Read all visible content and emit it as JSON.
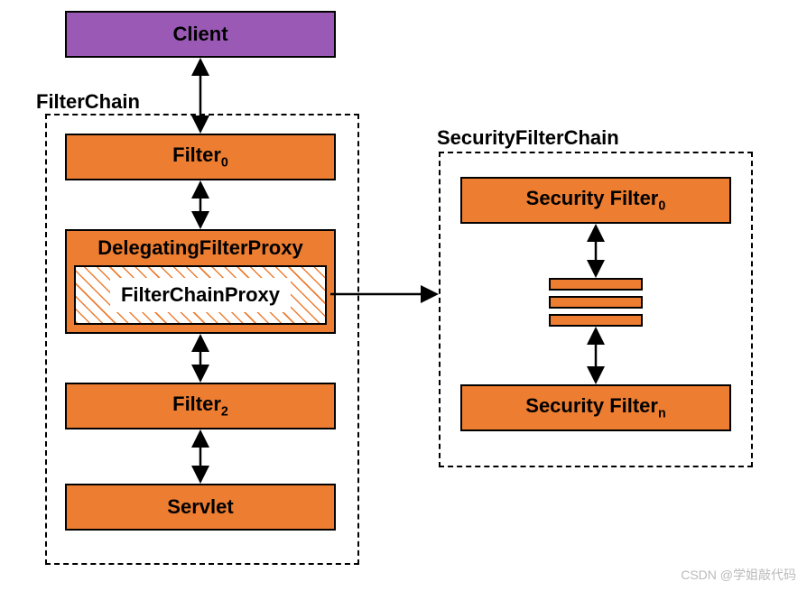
{
  "client": {
    "label": "Client"
  },
  "filterChain": {
    "label": "FilterChain",
    "filter0": {
      "name": "Filter",
      "sub": "0"
    },
    "delegating": {
      "label": "DelegatingFilterProxy"
    },
    "filterChainProxy": {
      "label": "FilterChainProxy"
    },
    "filter2": {
      "name": "Filter",
      "sub": "2"
    },
    "servlet": {
      "label": "Servlet"
    }
  },
  "securityFilterChain": {
    "label": "SecurityFilterChain",
    "security0": {
      "name": "Security Filter",
      "sub": "0"
    },
    "securityN": {
      "name": "Security Filter",
      "sub": "n"
    }
  },
  "watermark": "CSDN @学姐敲代码"
}
